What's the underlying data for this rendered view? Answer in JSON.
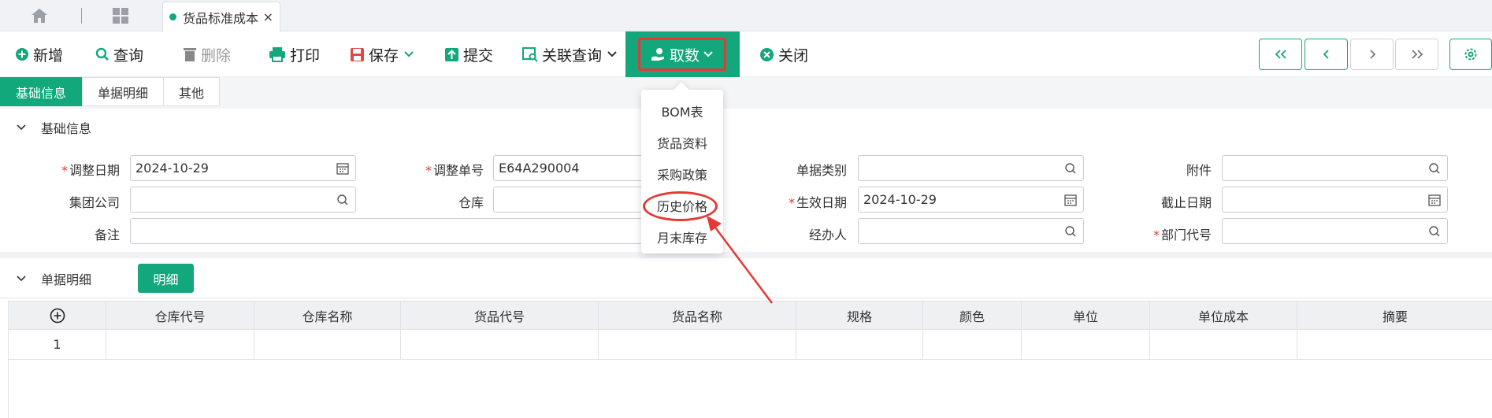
{
  "tabbar": {
    "active_tab": "货品标准成本",
    "close_glyph": "×"
  },
  "toolbar": {
    "new": "新增",
    "query": "查询",
    "delete": "删除",
    "print": "打印",
    "save": "保存",
    "submit": "提交",
    "related_query": "关联查询",
    "fetch": "取数",
    "close": "关闭"
  },
  "subtabs": [
    "基础信息",
    "单据明细",
    "其他"
  ],
  "basic_section": {
    "title": "基础信息"
  },
  "form": {
    "adjust_date": {
      "label": "调整日期",
      "value": "2024-10-29",
      "required": true
    },
    "adjust_no": {
      "label": "调整单号",
      "value": "E64A290004",
      "required": true
    },
    "doc_type": {
      "label": "单据类别",
      "value": ""
    },
    "attachment": {
      "label": "附件",
      "value": ""
    },
    "group_company": {
      "label": "集团公司",
      "value": ""
    },
    "warehouse": {
      "label": "仓库",
      "value": ""
    },
    "effective_date": {
      "label": "生效日期",
      "value": "2024-10-29",
      "required": true
    },
    "end_date": {
      "label": "截止日期",
      "value": ""
    },
    "remark": {
      "label": "备注",
      "value": ""
    },
    "handler": {
      "label": "经办人",
      "value": ""
    },
    "dept_code": {
      "label": "部门代号",
      "value": "",
      "required": true
    },
    "required_mark": "*"
  },
  "detail_section": {
    "title": "单据明细",
    "detail_button": "明细"
  },
  "table": {
    "columns": [
      "仓库代号",
      "仓库名称",
      "货品代号",
      "货品名称",
      "规格",
      "颜色",
      "单位",
      "单位成本",
      "摘要"
    ],
    "rows": [
      {
        "index": "1"
      }
    ]
  },
  "dropdown": {
    "items": [
      "BOM表",
      "货品资料",
      "采购政策",
      "历史价格",
      "月末库存"
    ],
    "highlighted": "历史价格"
  },
  "colors": {
    "accent": "#12a87b",
    "annotation": "#e53935"
  }
}
